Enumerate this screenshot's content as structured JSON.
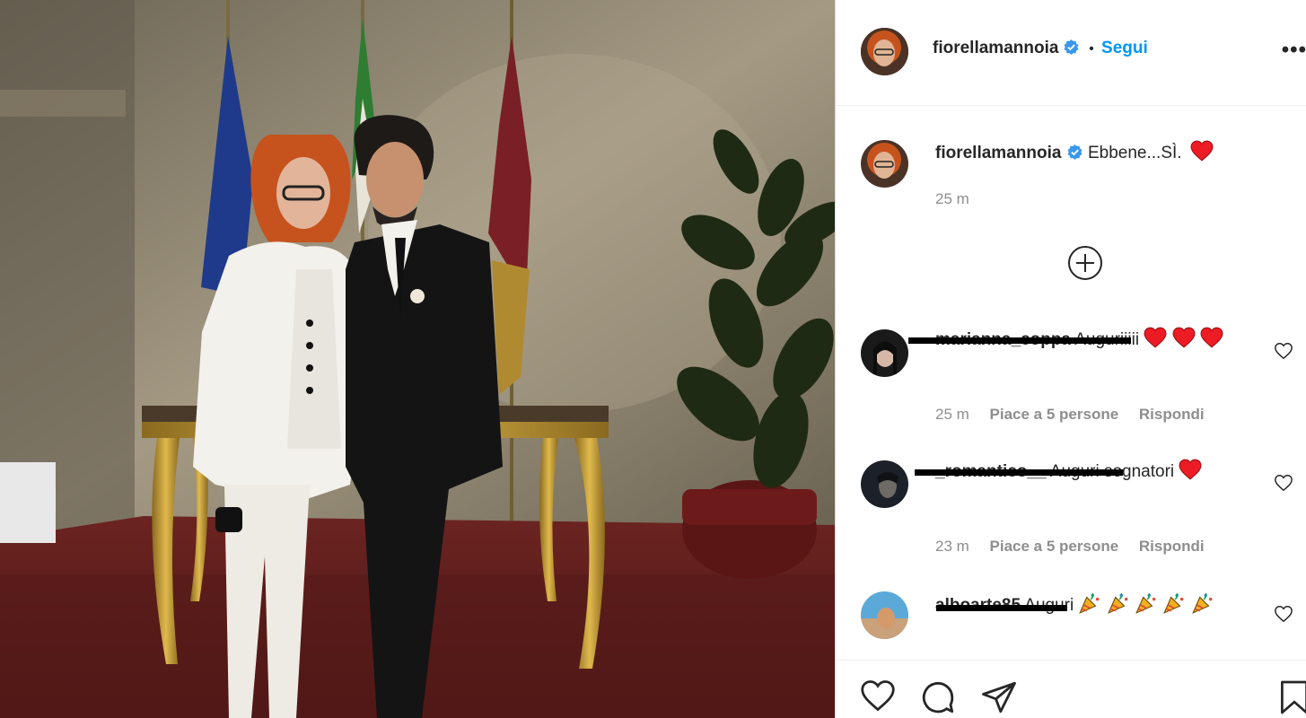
{
  "post": {
    "username": "fiorellamannoia",
    "follow_separator": "•",
    "follow_label": "Segui",
    "more_label": "•••"
  },
  "caption": {
    "username": "fiorellamannoia",
    "text": "Ebbene...SÌ.",
    "time": "25 m"
  },
  "load_more_icon": "plus-circle-icon",
  "comments": [
    {
      "username": "marianna_coppa",
      "text": "Auguriiiii",
      "emoji": [
        "red-heart",
        "red-heart",
        "red-heart"
      ],
      "time": "25 m",
      "likes": "Piace a 5 persone",
      "reply": "Rispondi"
    },
    {
      "username": "_romantico__",
      "text": "Auguri sognatori",
      "emoji": [
        "red-heart"
      ],
      "time": "23 m",
      "likes": "Piace a 5 persone",
      "reply": "Rispondi"
    },
    {
      "username": "alboarte85",
      "text": "Auguri",
      "emoji": [
        "party-popper",
        "party-popper",
        "party-popper",
        "party-popper",
        "party-popper"
      ]
    }
  ],
  "colors": {
    "link_blue": "#0095f6",
    "verified_blue": "#3897f0",
    "heart_red": "#ed1c24",
    "muted": "#8e8e8e"
  }
}
